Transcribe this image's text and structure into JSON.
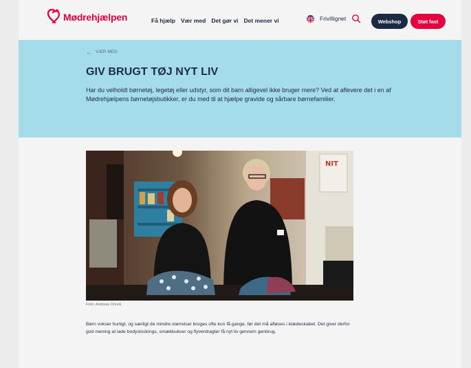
{
  "header": {
    "logo_text": "Mødrehjælpen",
    "nav": [
      "Få hjælp",
      "Vær med",
      "Det gør vi",
      "Det mener vi"
    ],
    "language_icon": "uk-flag-icon",
    "volunteer_link": "Frivillignet",
    "search_icon": "search-icon",
    "webshop_label": "Webshop",
    "support_label": "Støt fast"
  },
  "hero": {
    "breadcrumb": "VÆR MED",
    "title": "GIV BRUGT TØJ NYT LIV",
    "intro": "Har du velholdt børnetøj, legetøj eller udstyr, som dit barn alligevel ikke bruger mere? Ved at aflevere det i en af Mødrehjælpens børnetøjsbutikker, er du med til at hjælpe gravide og sårbare børnefamilier."
  },
  "article": {
    "photo_caption": "Foto: Andreas Omvik",
    "body": "Børn vokser hurtigt, og særligt de mindre størrelser bruges ofte kun få gange, før det må afløses i klædeskabet. Det giver derfor god mening at lade bodystockings, smækbukser og flyverdragter få nyt liv gennem genbrug."
  },
  "colors": {
    "brand_red": "#e4003f",
    "navy": "#1d2a44",
    "hero_blue": "#a5dcec"
  }
}
